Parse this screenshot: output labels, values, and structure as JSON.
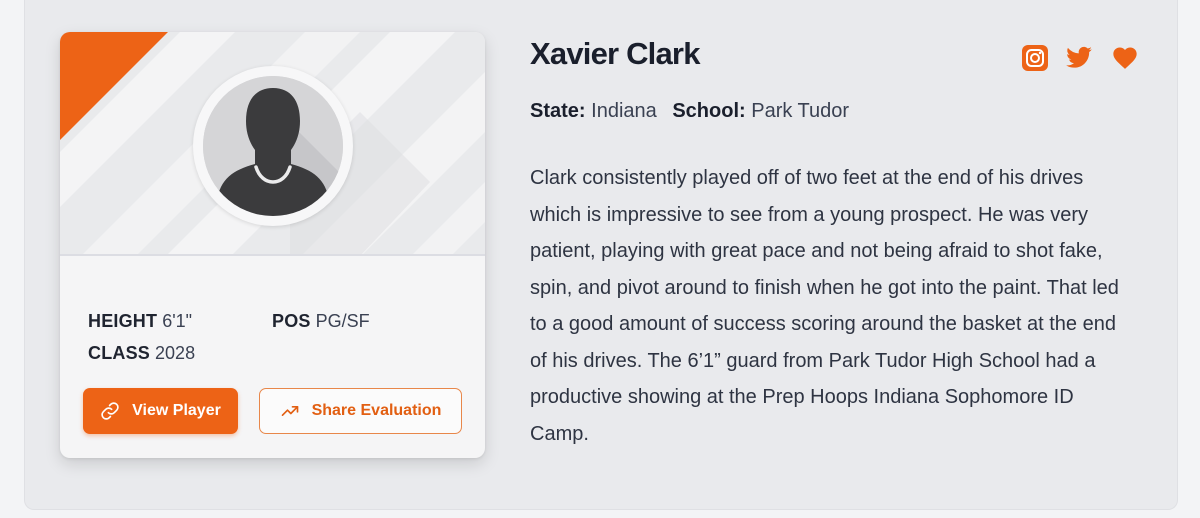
{
  "player": {
    "name": "Xavier Clark",
    "state_label": "State:",
    "state": "Indiana",
    "school_label": "School:",
    "school": "Park Tudor",
    "height_label": "HEIGHT",
    "height": "6'1\"",
    "pos_label": "POS",
    "pos": "PG/SF",
    "class_label": "CLASS",
    "class": "2028"
  },
  "evaluation": {
    "text": "Clark consistently played off of two feet at the end of his drives which is impressive to see from a young prospect. He was very patient, playing with great pace and not being afraid to shot fake, spin, and pivot around to finish when he got into the paint. That led to a good amount of success scoring around the basket at the end of his drives. The 6’1” guard from Park Tudor High School had a productive showing at the Prep Hoops Indiana Sophomore ID Camp."
  },
  "buttons": {
    "view_player": "View Player",
    "share_evaluation": "Share Evaluation"
  },
  "icons": {
    "view_player": "link-icon",
    "share_evaluation": "trending-up-icon",
    "social": [
      "instagram-icon",
      "twitter-icon",
      "heart-icon"
    ]
  },
  "colors": {
    "accent": "#ed6316",
    "name_text": "#1a1f2c",
    "body_text": "#2e3442",
    "panel_bg": "#e9eaed",
    "card_bg": "#f5f5f6"
  }
}
